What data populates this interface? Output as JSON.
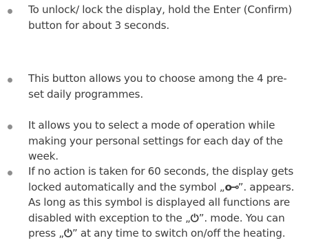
{
  "bullets": [
    {
      "lines": [
        "To unlock/ lock the display, hold the Enter (Confirm)",
        "button for about 3 seconds."
      ]
    },
    {
      "lines": [
        "This button allows you to choose among the 4 pre-",
        "set daily programmes."
      ]
    },
    {
      "lines": [
        "It allows you to select a mode of operation while",
        "making your personal settings for each day of the",
        "week."
      ]
    },
    {
      "line1_a": "If no action is taken for 60 seconds, the display gets",
      "line2_a": "locked automatically and the symbol „",
      "key_symbol": "o⊸",
      "line2_b": "”. appears.",
      "line3": "As long as this symbol is displayed all functions are",
      "line4_a": "disabled with exception to the „",
      "power_symbol": "⏻",
      "line4_b": "”. mode. You can",
      "line5_a": "press „",
      "line5_b": "” at any time to switch on/off the heating."
    }
  ]
}
